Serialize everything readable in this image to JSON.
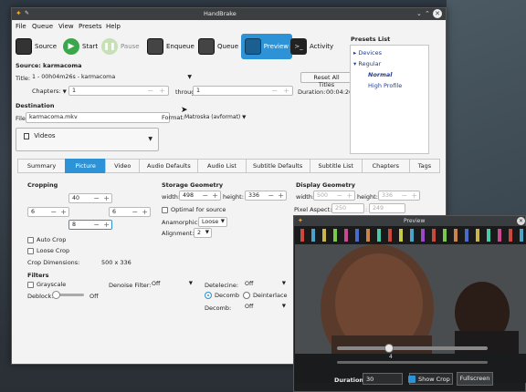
{
  "window": {
    "title": "HandBrake"
  },
  "menu": [
    "File",
    "Queue",
    "View",
    "Presets",
    "Help"
  ],
  "toolbar": {
    "source": "Source",
    "start": "Start",
    "pause": "Pause",
    "enqueue": "Enqueue",
    "queue": "Queue",
    "preview": "Preview",
    "activity": "Activity"
  },
  "source": {
    "label": "Source:",
    "name": "karmacoma",
    "title_label": "Title:",
    "title_value": "1 - 00h04m26s - karmacoma",
    "reset_all_titles": "Reset All Titles",
    "chapters_label": "Chapters:",
    "chapter_from": "1",
    "through": "through",
    "chapter_to": "1",
    "duration_label": "Duration:",
    "duration_value": "00:04:26"
  },
  "destination": {
    "heading": "Destination",
    "file_label": "File:",
    "file_value": "karmacoma.mkv",
    "format_label": "Format:",
    "format_value": "Matroska (avformat)",
    "folder": "Videos"
  },
  "presets": {
    "title": "Presets List",
    "groups": [
      {
        "label": "Devices",
        "expanded": false
      },
      {
        "label": "Regular",
        "expanded": true,
        "items": [
          "Normal",
          "High Profile"
        ]
      }
    ]
  },
  "tabs": [
    "Summary",
    "Picture",
    "Video",
    "Audio Defaults",
    "Audio List",
    "Subtitle Defaults",
    "Subtitle List",
    "Chapters",
    "Tags"
  ],
  "active_tab": "Picture",
  "cropping": {
    "heading": "Cropping",
    "top": "40",
    "left": "6",
    "right": "6",
    "bottom": "8",
    "auto_crop": "Auto Crop",
    "loose_crop": "Loose Crop",
    "dimensions_label": "Crop Dimensions:",
    "dimensions_value": "500 x 336"
  },
  "storage": {
    "heading": "Storage Geometry",
    "width_label": "width:",
    "width_value": "498",
    "height_label": "height:",
    "height_value": "336",
    "optimal": "Optimal for source",
    "anamorphic_label": "Anamorphic:",
    "anamorphic_value": "Loose",
    "alignment_label": "Alignment:",
    "alignment_value": "2"
  },
  "display": {
    "heading": "Display Geometry",
    "width_label": "width:",
    "width_value": "500",
    "height_label": "height:",
    "height_value": "336",
    "pixel_aspect_label": "Pixel Aspect:",
    "pixel_aspect_a": "250",
    "pixel_aspect_b": "249"
  },
  "filters": {
    "heading": "Filters",
    "grayscale": "Grayscale",
    "deblock_label": "Deblock:",
    "deblock_value": "Off",
    "denoise_label": "Denoise Filter:",
    "denoise_value": "Off",
    "detelecine_label": "Detelecine:",
    "detelecine_value": "Off",
    "decomb": "Decomb",
    "deinterlace": "Deinterlace",
    "decomb_label": "Decomb:",
    "decomb_value": "Off"
  },
  "preview": {
    "title": "Preview",
    "slider_value": "4",
    "duration_label": "Duration:",
    "duration_value": "30",
    "show_crop": "Show Crop",
    "fullscreen": "Fullscreen"
  },
  "colors": {
    "accent": "#2e93d6",
    "titlebar": "#3c3f42",
    "preset_item": "#1f3f9a"
  }
}
